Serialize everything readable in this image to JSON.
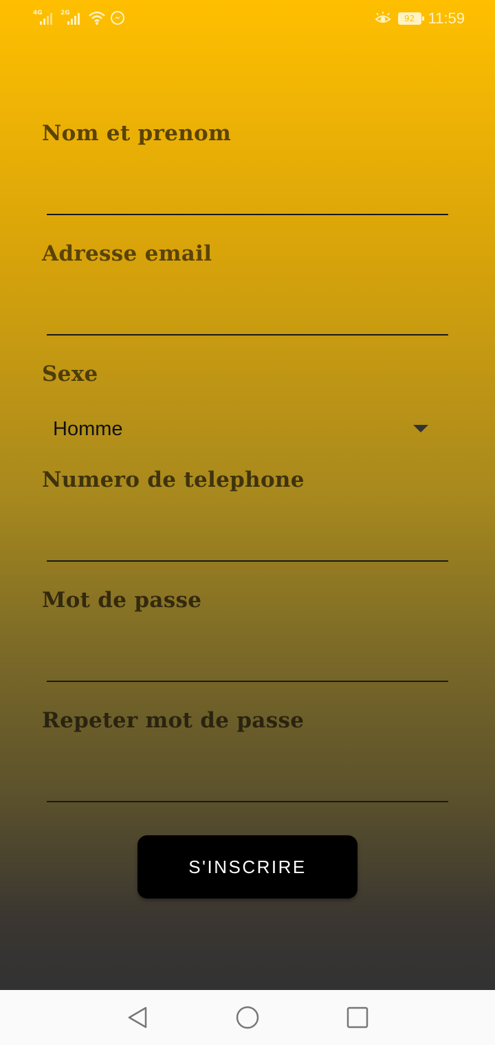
{
  "status_bar": {
    "signal1_label": "4G",
    "signal2_label": "2G",
    "battery": "92",
    "time": "11:59"
  },
  "form": {
    "name_label": "Nom et prenom",
    "email_label": "Adresse email",
    "sex_label": "Sexe",
    "sex_value": "Homme",
    "phone_label": "Numero de telephone",
    "password_label": "Mot de passe",
    "repeat_password_label": "Repeter mot de passe",
    "submit_label": "S'INSCRIRE"
  },
  "colors": {
    "gradient_top": "#FFBF00",
    "gradient_bottom": "#323232",
    "button": "#000000"
  }
}
